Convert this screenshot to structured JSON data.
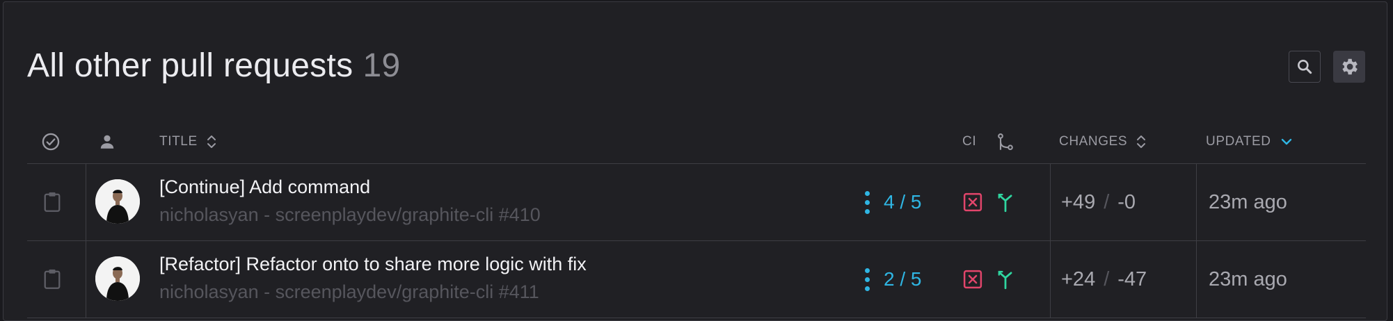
{
  "header": {
    "title": "All other pull requests",
    "count": "19",
    "search_icon": "search-icon",
    "settings_icon": "gear-icon"
  },
  "columns": {
    "status_icon": "check-circle-icon",
    "author_icon": "person-icon",
    "title": "TITLE",
    "ci": "CI",
    "merge_icon": "branch-icon",
    "changes": "CHANGES",
    "updated": "UPDATED"
  },
  "rows": [
    {
      "title": "[Continue] Add command",
      "subtitle": "nicholasyan - screenplaydev/graphite-cli #410",
      "reviews": "4 / 5",
      "additions": "+49",
      "separator": "/",
      "deletions": "-0",
      "updated": "23m ago"
    },
    {
      "title": "[Refactor] Refactor onto to share more logic with fix",
      "subtitle": "nicholasyan - screenplaydev/graphite-cli #411",
      "reviews": "2 / 5",
      "additions": "+24",
      "separator": "/",
      "deletions": "-47",
      "updated": "23m ago"
    }
  ],
  "colors": {
    "accent": "#2fb6e4",
    "ci_fail": "#e2456b",
    "merge_green": "#2fd6a0",
    "background": "#202024"
  }
}
